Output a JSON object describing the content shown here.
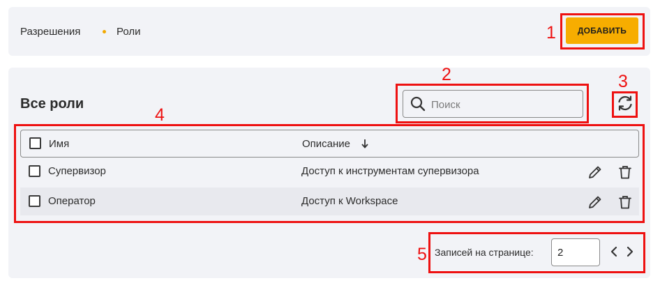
{
  "breadcrumb": {
    "items": [
      "Разрешения",
      "Роли"
    ]
  },
  "toolbar": {
    "add_label": "ДОБАВИТЬ"
  },
  "main": {
    "title": "Все роли"
  },
  "search": {
    "placeholder": "Поиск"
  },
  "table": {
    "headers": {
      "name": "Имя",
      "description": "Описание"
    },
    "sort": {
      "column": "description",
      "direction": "desc"
    },
    "rows": [
      {
        "name": "Супервизор",
        "description": "Доступ к инструментам супервизора"
      },
      {
        "name": "Оператор",
        "description": "Доступ к Workspace"
      }
    ]
  },
  "pagination": {
    "label": "Записей на странице:",
    "per_page": "2"
  },
  "annotations": [
    "1",
    "2",
    "3",
    "4",
    "5"
  ],
  "colors": {
    "accent": "#f7ad00",
    "annotation": "#ee1111",
    "panel": "#f2f3f7"
  },
  "icons": [
    "search-icon",
    "refresh-icon",
    "sort-arrow-icon",
    "pencil-icon",
    "trash-icon",
    "chevron-left-icon",
    "chevron-right-icon"
  ]
}
